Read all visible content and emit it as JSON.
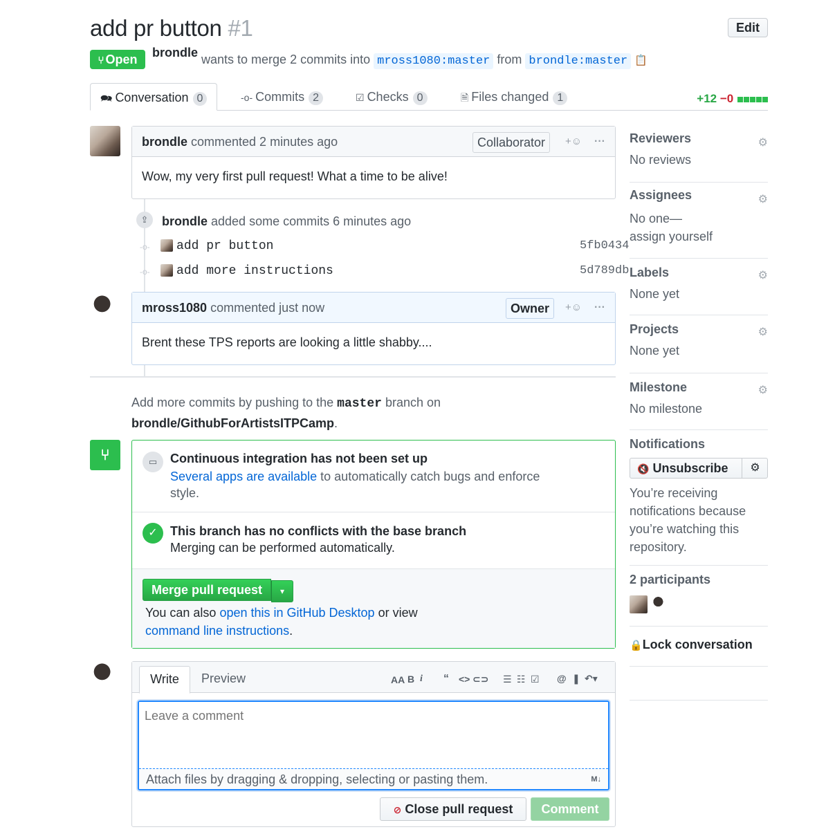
{
  "header": {
    "title": "add pr button",
    "number": "#1",
    "edit_label": "Edit",
    "state": "Open",
    "author": "brondle",
    "merge_text": "wants to merge 2 commits into",
    "base_branch": "mross1080:master",
    "from_text": "from",
    "head_branch": "brondle:master"
  },
  "tabs": [
    {
      "label": "Conversation",
      "count": "0"
    },
    {
      "label": "Commits",
      "count": "2"
    },
    {
      "label": "Checks",
      "count": "0"
    },
    {
      "label": "Files changed",
      "count": "1"
    }
  ],
  "diffstat": {
    "additions": "+12",
    "deletions": "−0"
  },
  "comment1": {
    "author": "brondle",
    "action": "commented 2 minutes ago",
    "role": "Collaborator",
    "body": "Wow, my very first pull request! What a time to be alive!"
  },
  "commits_event": {
    "author": "brondle",
    "action": "added some commits 6 minutes ago",
    "commits": [
      {
        "message": "add pr button",
        "sha": "5fb0434"
      },
      {
        "message": "add more instructions",
        "sha": "5d789db"
      }
    ]
  },
  "comment2": {
    "author": "mross1080",
    "action": "commented just now",
    "role": "Owner",
    "body": "Brent these TPS reports are looking a little shabby...."
  },
  "push_hint": {
    "prefix": "Add more commits by pushing to the",
    "branch": "master",
    "middle": "branch on",
    "repo": "brondle/GithubForArtistsITPCamp",
    "suffix": "."
  },
  "merge_box": {
    "ci_title": "Continuous integration has not been set up",
    "ci_link": "Several apps are available",
    "ci_rest": "to automatically catch bugs and enforce",
    "ci_rest2": "style.",
    "conflict_title": "This branch has no conflicts with the base branch",
    "conflict_sub": "Merging can be performed automatically.",
    "merge_label": "Merge pull request",
    "also_prefix": "You can also",
    "desktop_link": "open this in GitHub Desktop",
    "also_mid": "or view",
    "cli_link": "command line instructions",
    "also_suffix": "."
  },
  "editor": {
    "write_tab": "Write",
    "preview_tab": "Preview",
    "placeholder": "Leave a comment",
    "attach_text": "Attach files by dragging & dropping, selecting or pasting them.",
    "close_label": "Close pull request",
    "comment_label": "Comment"
  },
  "sidebar": {
    "reviewers": {
      "title": "Reviewers",
      "value": "No reviews"
    },
    "assignees": {
      "title": "Assignees",
      "value": "No one—",
      "link": "assign yourself"
    },
    "labels": {
      "title": "Labels",
      "value": "None yet"
    },
    "projects": {
      "title": "Projects",
      "value": "None yet"
    },
    "milestone": {
      "title": "Milestone",
      "value": "No milestone"
    },
    "notifications": {
      "title": "Notifications",
      "button": "Unsubscribe",
      "reason_lines": [
        "You’re receiving",
        "notifications because",
        "you’re watching this",
        "repository."
      ]
    },
    "participants": "2 participants",
    "lock": "Lock conversation"
  },
  "colors": {
    "open_green": "#2cbe4e",
    "link_blue": "#0366d6",
    "deletion_red": "#cb2431"
  }
}
